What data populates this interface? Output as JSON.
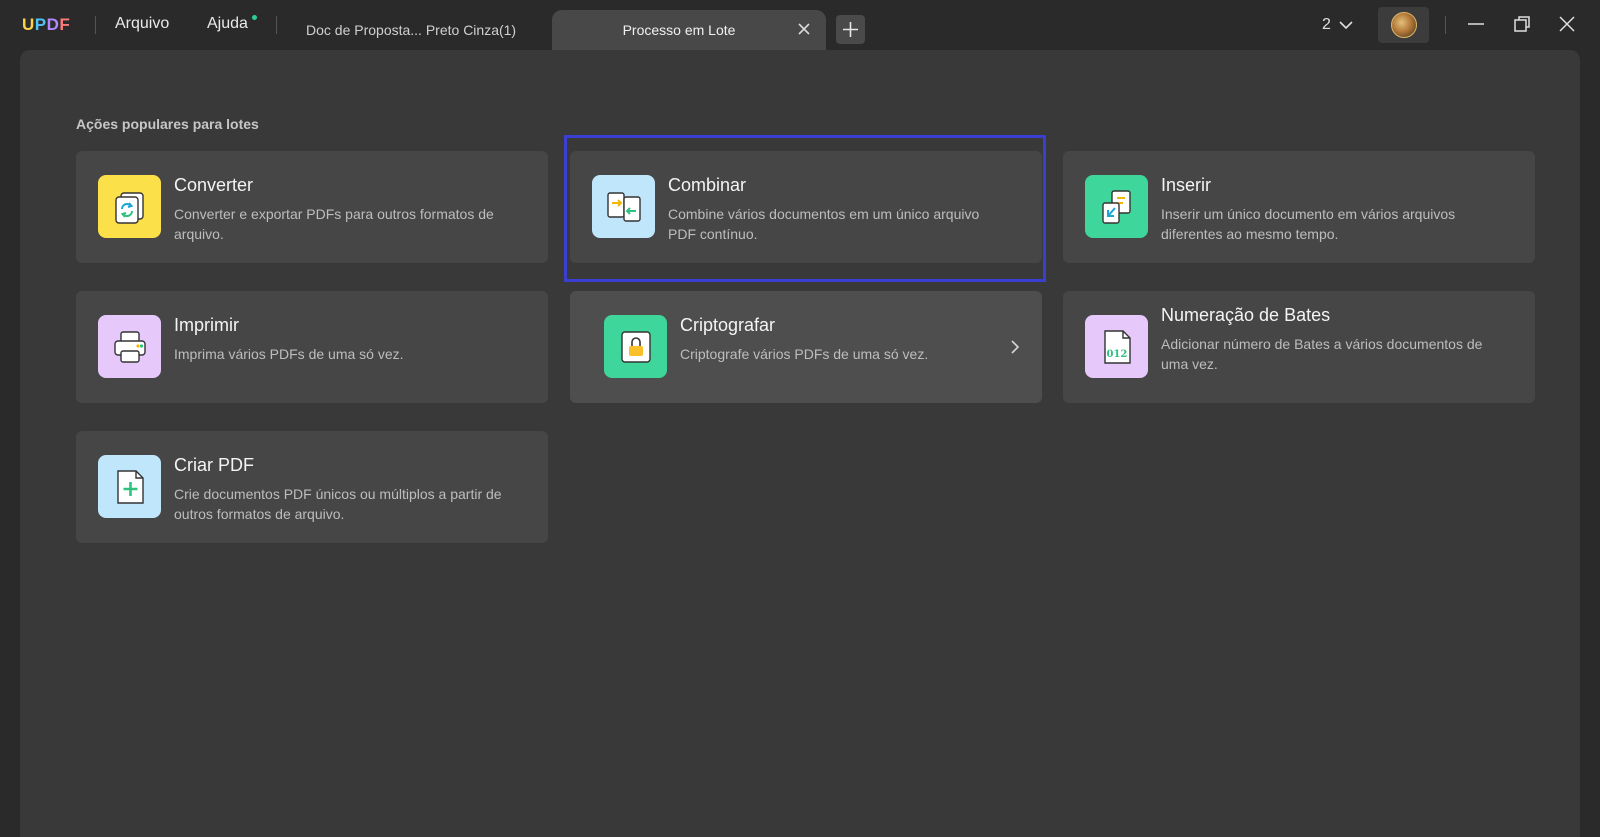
{
  "titlebar": {
    "logo": [
      "U",
      "P",
      "D",
      "F"
    ],
    "menu": {
      "file": "Arquivo",
      "help": "Ajuda"
    },
    "tabs": [
      {
        "label": "Doc de Proposta... Preto Cinza(1)"
      },
      {
        "label": "Processo em Lote"
      }
    ],
    "window_count": "2",
    "colors": {
      "logo_u": "#f9d24a",
      "logo_p": "#4fc3f7",
      "logo_d": "#b388ff",
      "logo_f": "#ff7a7a",
      "notify_dot": "#2ecc9a"
    }
  },
  "main": {
    "section_title": "Ações populares para lotes",
    "cards": [
      {
        "id": "converter",
        "title": "Converter",
        "desc": "Converter e exportar PDFs para outros formatos de arquivo.",
        "icon": "convert-icon",
        "color": "#fce04a"
      },
      {
        "id": "combinar",
        "title": "Combinar",
        "desc": "Combine vários documentos em um único arquivo PDF contínuo.",
        "icon": "combine-icon",
        "color": "#bfe6fb"
      },
      {
        "id": "inserir",
        "title": "Inserir",
        "desc": "Inserir um único documento em vários arquivos diferentes ao mesmo tempo.",
        "icon": "insert-icon",
        "color": "#3ed69a"
      },
      {
        "id": "imprimir",
        "title": "Imprimir",
        "desc": "Imprima vários PDFs de uma só vez.",
        "icon": "printer-icon",
        "color": "#e7c8fa"
      },
      {
        "id": "criptografar",
        "title": "Criptografar",
        "desc": "Criptografe vários PDFs de uma só vez.",
        "icon": "lock-icon",
        "color": "#3ed69a"
      },
      {
        "id": "bates",
        "title": "Numeração de Bates",
        "desc": "Adicionar número de Bates a vários documentos de uma vez.",
        "icon": "bates-number-icon",
        "color": "#e7c8fa",
        "icon_text": "012"
      },
      {
        "id": "criar",
        "title": "Criar PDF",
        "desc": "Crie documentos PDF únicos ou múltiplos a partir de outros formatos de arquivo.",
        "icon": "create-pdf-icon",
        "color": "#bfe6fb"
      }
    ],
    "highlight_color": "#3b3fd1"
  }
}
